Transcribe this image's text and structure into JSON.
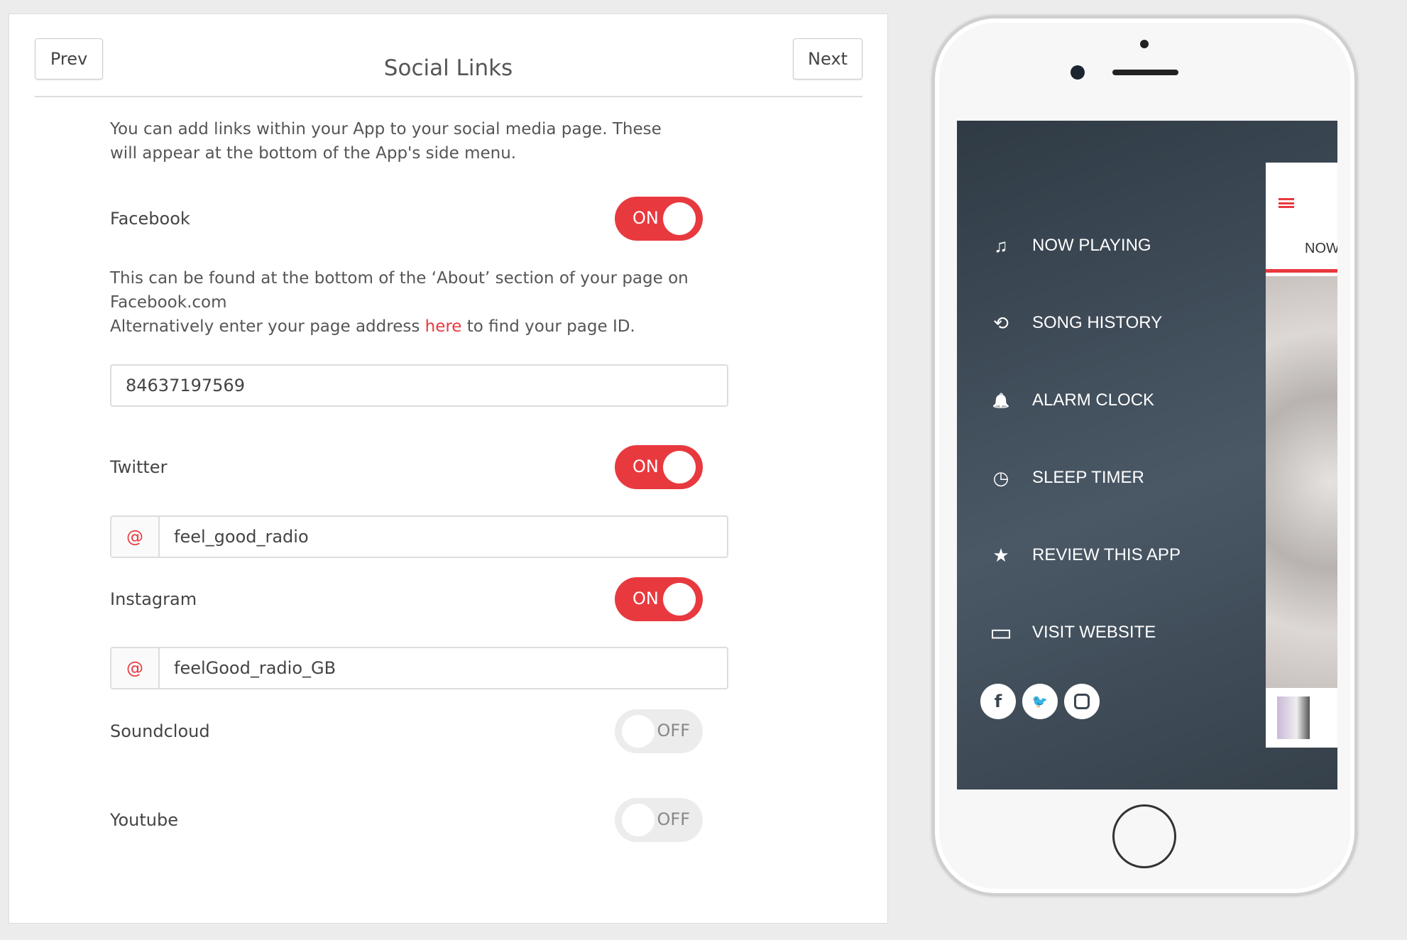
{
  "header": {
    "prev": "Prev",
    "title": "Social Links",
    "next": "Next"
  },
  "intro": "You can add links within your App to your social media page. These will appear at the bottom of the App's side menu.",
  "facebook": {
    "label": "Facebook",
    "toggle": "ON",
    "help1": "This can be found at the bottom of the ‘About’ section of your page on Facebook.com",
    "help2a": "Alternatively enter your page address ",
    "help_link": "here",
    "help2b": " to find your page ID.",
    "value": "84637197569"
  },
  "twitter": {
    "label": "Twitter",
    "toggle": "ON",
    "prefix": "@",
    "value": "feel_good_radio"
  },
  "instagram": {
    "label": "Instagram",
    "toggle": "ON",
    "prefix": "@",
    "value": "feelGood_radio_GB"
  },
  "soundcloud": {
    "label": "Soundcloud",
    "toggle": "OFF"
  },
  "youtube": {
    "label": "Youtube",
    "toggle": "OFF"
  },
  "phone": {
    "menu": [
      {
        "icon": "music-note-icon",
        "glyph": "♫",
        "label": "NOW PLAYING"
      },
      {
        "icon": "history-icon",
        "glyph": "⟲",
        "label": "SONG HISTORY"
      },
      {
        "icon": "bell-icon",
        "glyph": "🔔",
        "label": "ALARM CLOCK"
      },
      {
        "icon": "clock-icon",
        "glyph": "◷",
        "label": "SLEEP TIMER"
      },
      {
        "icon": "star-icon",
        "glyph": "★",
        "label": "REVIEW THIS APP"
      },
      {
        "icon": "browser-window-icon",
        "glyph": "▭",
        "label": "VISIT WEBSITE"
      }
    ],
    "social": [
      "f",
      "t",
      "ig"
    ],
    "tab": "NOW"
  },
  "colors": {
    "accent": "#e8393f",
    "menu_bg": "#3e4a55"
  }
}
